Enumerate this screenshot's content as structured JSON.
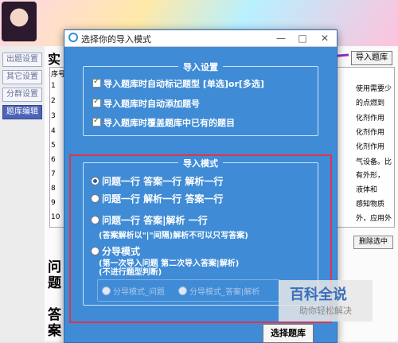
{
  "app": {
    "title_initial": "实",
    "import_button": "导入题库",
    "delete_button": "删除选中",
    "column_header": "序号",
    "row_numbers": [
      "1",
      "2",
      "3",
      "4",
      "5",
      "6",
      "7",
      "8",
      "9",
      "10"
    ],
    "right_snippets": [
      "使用需要少",
      "的点燃到",
      "化剂作用",
      "化剂作用",
      "化剂作用",
      "气设备。比",
      "有外形，",
      "液体和",
      "感知物质",
      "外，应用外"
    ],
    "left_nav": [
      "出题设置",
      "其它设置",
      "分群设置",
      "题库编辑"
    ],
    "label_question": "问\n题",
    "label_answer": "答\n案"
  },
  "dialog": {
    "title": "选择你的导入模式",
    "controls": {
      "minimize": "—",
      "maximize": "□",
      "close": "✕"
    },
    "import_settings": {
      "title": "导入设置",
      "options": [
        "导入题库时自动标记题型 [单选]or[多选]",
        "导入题库时自动添加题号",
        "导入题库时覆盖题库中已有的题目"
      ]
    },
    "import_mode": {
      "title": "导入模式",
      "options": [
        "问题一行 答案一行 解析一行",
        "问题一行 解析一行 答案一行",
        "问题一行 答案|解析 一行",
        "分导模式"
      ],
      "option3_note": "(答案解析以\"|\"间隔)解析不可以只写答案)",
      "option4_note_1": "(第一次导入问题 第二次导入答案|解析)",
      "option4_note_2": "(不进行题型判断)",
      "sub_options": [
        "分导模式_问题",
        "分导模式_答案|解析"
      ]
    },
    "select_button": "选择题库"
  },
  "watermark": {
    "main": "百科全说",
    "sub": "助你轻松解决"
  }
}
